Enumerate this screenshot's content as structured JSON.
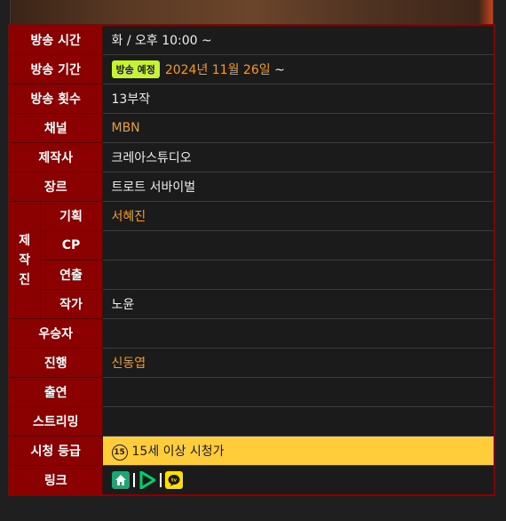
{
  "rows": {
    "air_time": {
      "label": "방송 시간",
      "value": "화 / 오후 10:00 ~"
    },
    "air_period": {
      "label": "방송 기간",
      "badge": "방송 예정",
      "value": "2024년 11월 26일",
      "suffix": " ~"
    },
    "episodes": {
      "label": "방송 횟수",
      "value": "13부작"
    },
    "channel": {
      "label": "채널",
      "value": "MBN"
    },
    "studio": {
      "label": "제작사",
      "value": "크레아스튜디오"
    },
    "genre": {
      "label": "장르",
      "value": "트로트 서바이벌"
    },
    "staff": {
      "group_label": [
        "제",
        "작",
        "진"
      ],
      "planning": {
        "label": "기획",
        "value": "서혜진"
      },
      "cp": {
        "label": "CP",
        "value": ""
      },
      "director": {
        "label": "연출",
        "value": ""
      },
      "writer": {
        "label": "작가",
        "value": "노윤"
      }
    },
    "winner": {
      "label": "우승자",
      "value": ""
    },
    "host": {
      "label": "진행",
      "value": "신동엽"
    },
    "cast": {
      "label": "출연",
      "value": ""
    },
    "streaming": {
      "label": "스트리밍",
      "value": ""
    },
    "rating": {
      "label": "시청 등급",
      "age": "15",
      "value": "15세 이상 시청가"
    },
    "links": {
      "label": "링크",
      "icons": [
        "home-icon",
        "play-icon",
        "kakaotv-icon"
      ]
    }
  },
  "colors": {
    "header_bg": "#8b0000",
    "link_text": "#f59b1f",
    "badge_bg": "#c6f432",
    "rating_bg": "#ffcd3a",
    "home_icon_bg": "#1ea672",
    "play_icon": "#00d06b",
    "kakao_icon_bg": "#ffde00"
  }
}
